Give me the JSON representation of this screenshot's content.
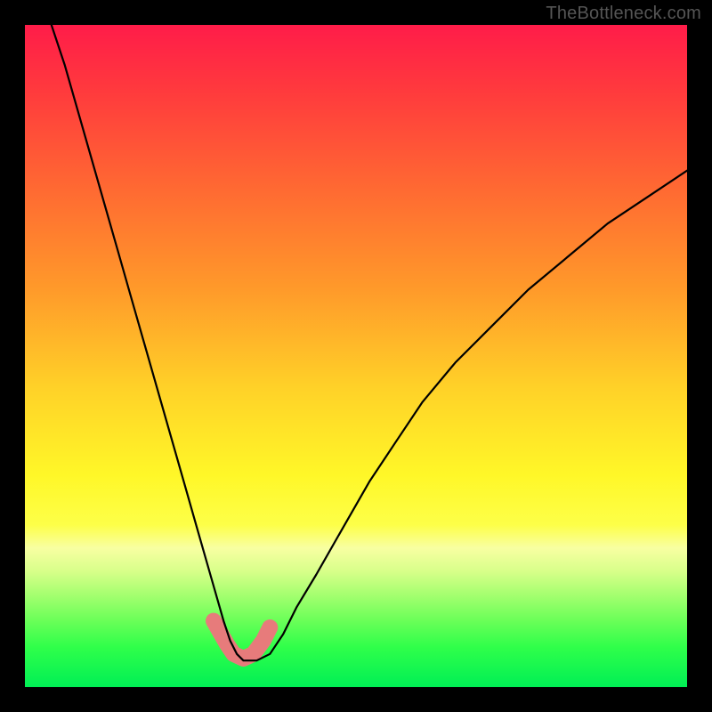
{
  "watermark": "TheBottleneck.com",
  "chart_data": {
    "type": "line",
    "title": "",
    "xlabel": "",
    "ylabel": "",
    "xlim": [
      0,
      100
    ],
    "ylim": [
      0,
      100
    ],
    "series": [
      {
        "name": "curve",
        "x": [
          4,
          6,
          8,
          10,
          12,
          14,
          16,
          18,
          20,
          22,
          24,
          26,
          28,
          30,
          31,
          32,
          33,
          34,
          35,
          37,
          39,
          41,
          44,
          48,
          52,
          56,
          60,
          65,
          70,
          76,
          82,
          88,
          94,
          100
        ],
        "y": [
          100,
          94,
          87,
          80,
          73,
          66,
          59,
          52,
          45,
          38,
          31,
          24,
          17,
          10,
          7,
          5,
          4,
          4,
          4,
          5,
          8,
          12,
          17,
          24,
          31,
          37,
          43,
          49,
          54,
          60,
          65,
          70,
          74,
          78
        ]
      },
      {
        "name": "highlight-band",
        "x": [
          28.5,
          30.5,
          31.5,
          33.0,
          34.5,
          36.0,
          37.0
        ],
        "y": [
          10.0,
          6.5,
          5.0,
          4.3,
          5.0,
          7.0,
          9.0
        ]
      }
    ],
    "colors": {
      "curve": "#000000",
      "highlight": "#e77b7b",
      "gradient_top": "#ff1c49",
      "gradient_bottom": "#00ef55"
    }
  }
}
